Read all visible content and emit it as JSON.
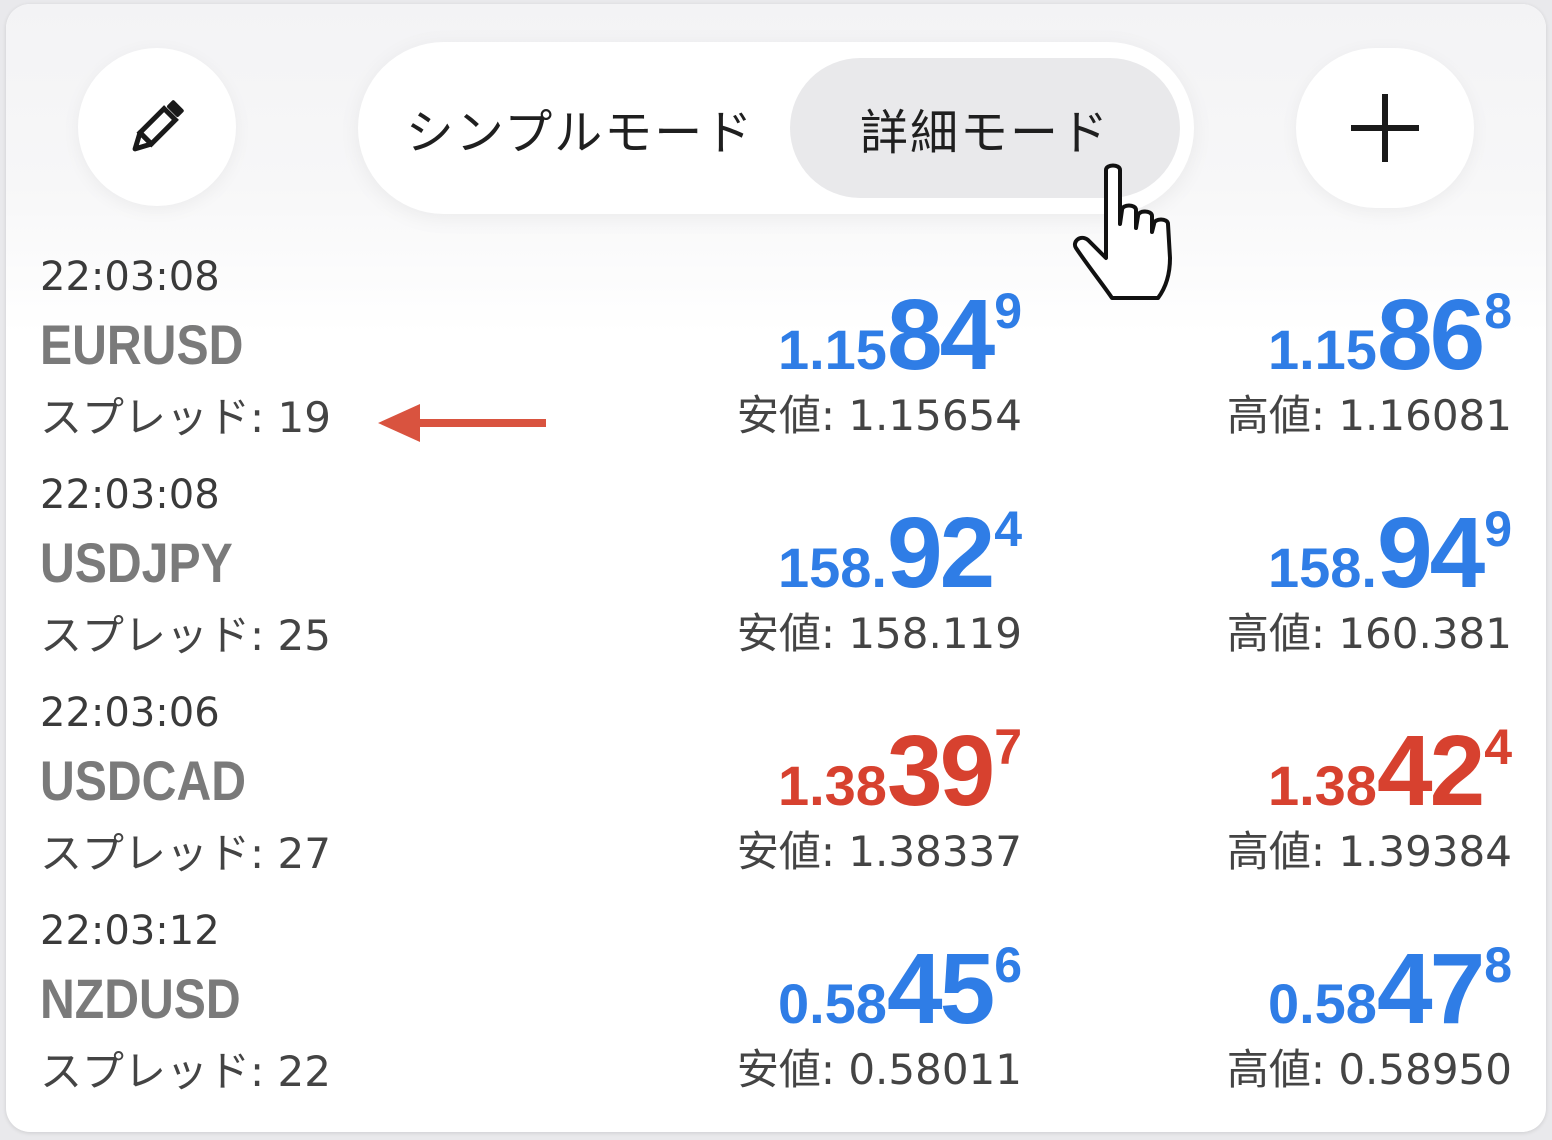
{
  "toolbar": {
    "edit_icon": "pencil-icon",
    "add_icon": "plus-icon",
    "mode_simple": "シンプルモード",
    "mode_detail": "詳細モード",
    "active_mode": "detail"
  },
  "colors": {
    "up": "#2f7de6",
    "down": "#d7412f",
    "arrow": "#d9533f"
  },
  "quotes": [
    {
      "time": "22:03:08",
      "symbol": "EURUSD",
      "spread": "スプレッド: 19",
      "direction": "up",
      "bid": {
        "small": "1.15",
        "big": "84",
        "sup": "9"
      },
      "ask": {
        "small": "1.15",
        "big": "86",
        "sup": "8"
      },
      "low": "安値: 1.15654",
      "high": "高値: 1.16081"
    },
    {
      "time": "22:03:08",
      "symbol": "USDJPY",
      "spread": "スプレッド: 25",
      "direction": "up",
      "bid": {
        "small": "158.",
        "big": "92",
        "sup": "4"
      },
      "ask": {
        "small": "158.",
        "big": "94",
        "sup": "9"
      },
      "low": "安値: 158.119",
      "high": "高値: 160.381"
    },
    {
      "time": "22:03:06",
      "symbol": "USDCAD",
      "spread": "スプレッド: 27",
      "direction": "down",
      "bid": {
        "small": "1.38",
        "big": "39",
        "sup": "7"
      },
      "ask": {
        "small": "1.38",
        "big": "42",
        "sup": "4"
      },
      "low": "安値: 1.38337",
      "high": "高値: 1.39384"
    },
    {
      "time": "22:03:12",
      "symbol": "NZDUSD",
      "spread": "スプレッド: 22",
      "direction": "up",
      "bid": {
        "small": "0.58",
        "big": "45",
        "sup": "6"
      },
      "ask": {
        "small": "0.58",
        "big": "47",
        "sup": "8"
      },
      "low": "安値: 0.58011",
      "high": "高値: 0.58950"
    }
  ],
  "annotations": {
    "spread_arrow_icon": "arrow-left-icon",
    "pointer_icon": "hand-pointer-icon"
  }
}
